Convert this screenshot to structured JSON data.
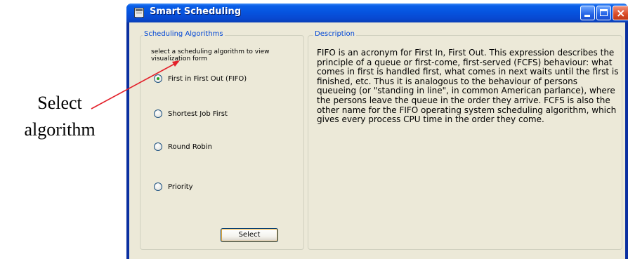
{
  "annotation": {
    "line1": "Select",
    "line2": "algorithm",
    "arrow_color": "#e3202a"
  },
  "window": {
    "title": "Smart Scheduling",
    "close_glyph": "×"
  },
  "algorithms": {
    "group_title": "Scheduling Algorithms",
    "hint": "select a scheduling algorithm to view visualization form",
    "options": [
      {
        "label": "First in First Out (FIFO)",
        "checked": true
      },
      {
        "label": "Shortest Job First",
        "checked": false
      },
      {
        "label": "Round Robin",
        "checked": false
      },
      {
        "label": "Priority",
        "checked": false
      }
    ],
    "select_button": "Select"
  },
  "description": {
    "group_title": "Description",
    "text": "FIFO is an acronym for First In, First Out. This expression describes the principle of a queue or first-come, first-served (FCFS) behaviour: what comes in first is handled first, what comes in next waits until the first is finished, etc. Thus it is analogous to the behaviour of persons queueing (or \"standing in line\", in common American parlance), where the persons leave the queue in the order they arrive. FCFS is also the other name for the FIFO operating system scheduling algorithm, which gives every process CPU time in the order they come."
  },
  "icons": {
    "app": "window-app-icon",
    "minimize": "minimize-icon",
    "maximize": "maximize-icon",
    "close": "close-icon"
  },
  "colors": {
    "title_bar": "#0654df",
    "client_bg": "#ece9d8",
    "group_title": "#0046d5",
    "radio_checked": "#21a121"
  }
}
